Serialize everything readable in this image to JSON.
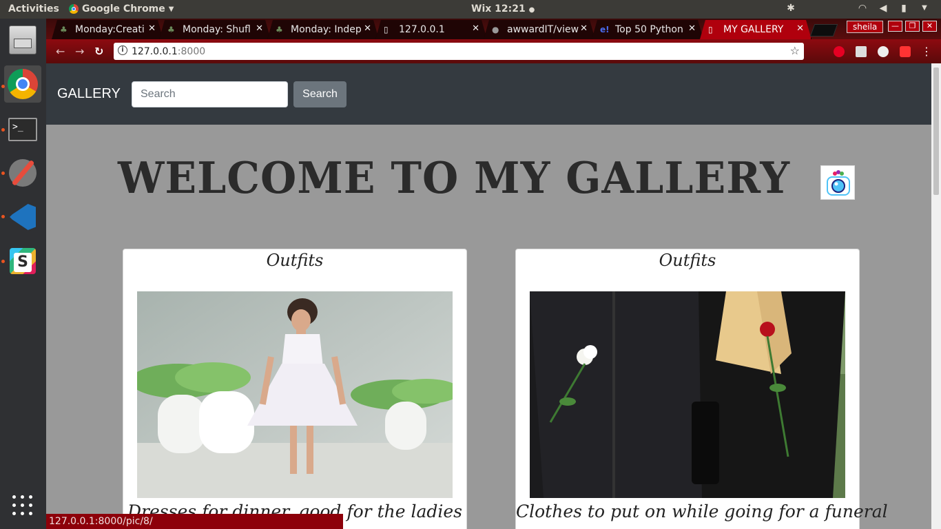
{
  "system": {
    "activities": "Activities",
    "app_name": "Google Chrome",
    "clock": "Wix 12:21"
  },
  "browser": {
    "tabs": [
      {
        "title": "Monday:Creati",
        "icon": "plant-icon"
      },
      {
        "title": "Monday: Shufl",
        "icon": "plant-icon"
      },
      {
        "title": "Monday: Indep",
        "icon": "plant-icon"
      },
      {
        "title": "127.0.0.1",
        "icon": "page-icon"
      },
      {
        "title": "awwardIT/view",
        "icon": "github-icon"
      },
      {
        "title": "Top 50 Python",
        "icon": "e-icon"
      },
      {
        "title": "MY GALLERY",
        "icon": "page-icon"
      }
    ],
    "profile": "sheila",
    "url_host": "127.0.0.1",
    "url_port": ":8000",
    "status_url": "127.0.0.1:8000/pic/8/"
  },
  "page": {
    "brand": "GALLERY",
    "search_placeholder": "Search",
    "search_button": "Search",
    "heading": "WELCOME TO MY GALLERY",
    "cards": [
      {
        "title": "Outfits",
        "caption": "Dresses for dinner, good for the ladies"
      },
      {
        "title": "Outfits",
        "caption": "Clothes to put on while going for a funeral"
      }
    ]
  },
  "colors": {
    "navbar": "#343a40",
    "page_bg": "#999999",
    "chrome_theme": "#b0000d"
  }
}
